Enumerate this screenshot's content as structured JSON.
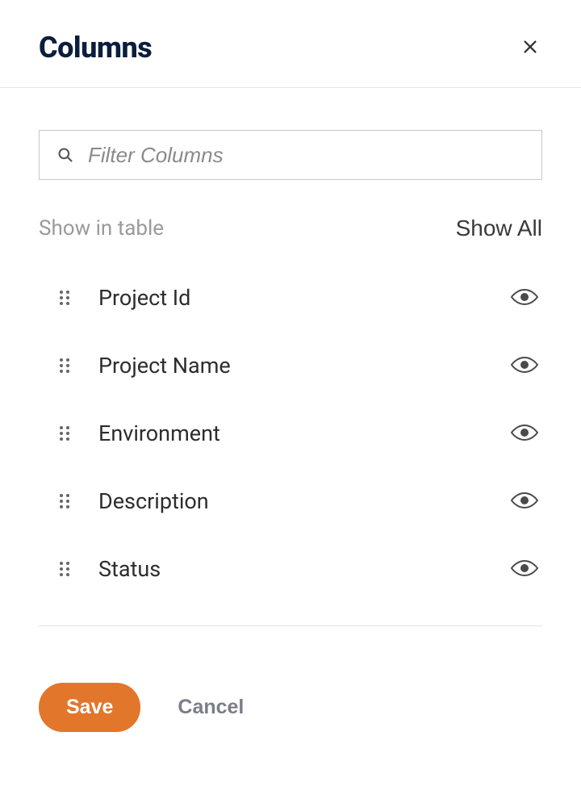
{
  "header": {
    "title": "Columns"
  },
  "search": {
    "placeholder": "Filter Columns",
    "value": ""
  },
  "subheader": {
    "show_in_table_label": "Show in table",
    "show_all_label": "Show All"
  },
  "columns": [
    {
      "label": "Project Id",
      "visible": true
    },
    {
      "label": "Project Name",
      "visible": true
    },
    {
      "label": "Environment",
      "visible": true
    },
    {
      "label": "Description",
      "visible": true
    },
    {
      "label": "Status",
      "visible": true
    }
  ],
  "footer": {
    "save_label": "Save",
    "cancel_label": "Cancel"
  }
}
